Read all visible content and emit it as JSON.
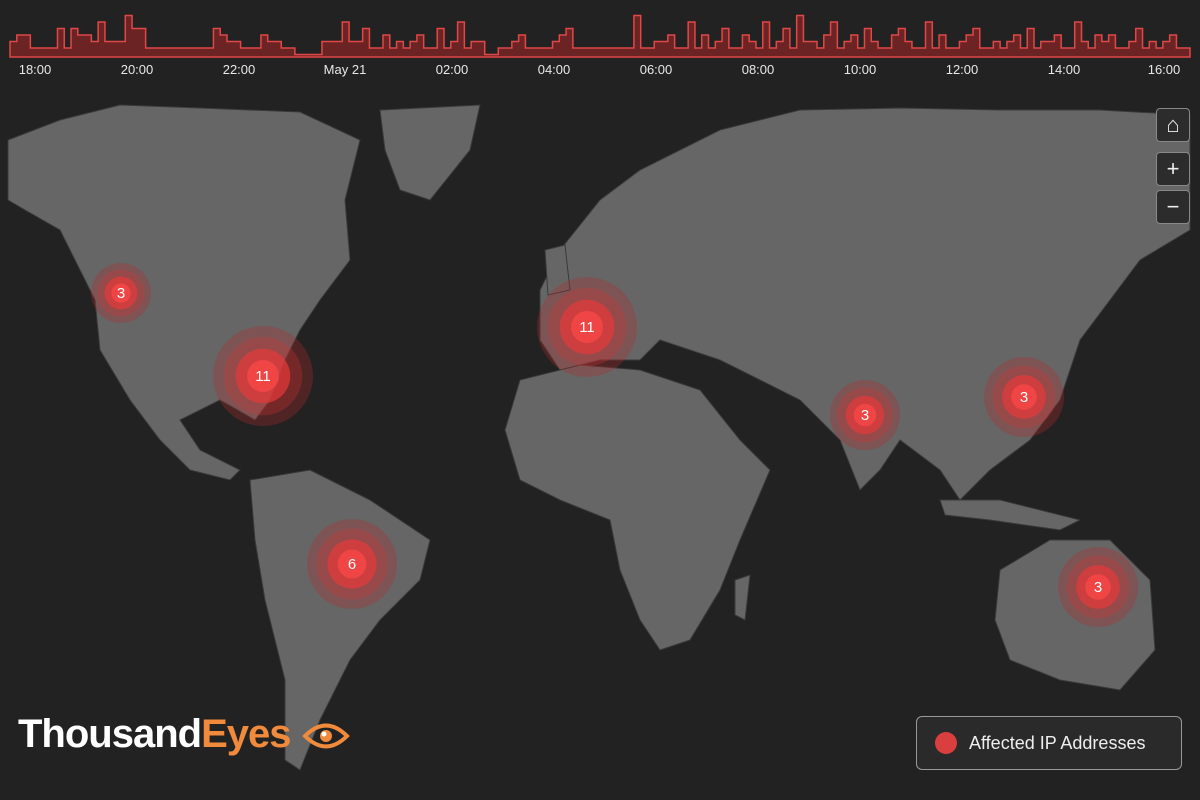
{
  "timeline": {
    "ticks": [
      "18:00",
      "20:00",
      "22:00",
      "May 21",
      "02:00",
      "04:00",
      "06:00",
      "08:00",
      "10:00",
      "12:00",
      "14:00",
      "16:00"
    ],
    "values": [
      1,
      2,
      2,
      0,
      0,
      0,
      0,
      3,
      0,
      3,
      2,
      2,
      1,
      4,
      1,
      1,
      1,
      5,
      3,
      3,
      0,
      0,
      0,
      0,
      0,
      0,
      0,
      0,
      0,
      0,
      3,
      2,
      1,
      1,
      0,
      0,
      0,
      2,
      1,
      1,
      0,
      0,
      -1,
      -1,
      -1,
      -1,
      1,
      1,
      1,
      4,
      1,
      1,
      3,
      0,
      0,
      2,
      0,
      1,
      0,
      1,
      2,
      0,
      0,
      3,
      0,
      1,
      4,
      0,
      1,
      1,
      -1,
      -1,
      0,
      0,
      1,
      2,
      0,
      0,
      0,
      0,
      1,
      2,
      3,
      0,
      0,
      0,
      0,
      0,
      0,
      0,
      0,
      0,
      5,
      0,
      0,
      1,
      1,
      2,
      0,
      0,
      4,
      0,
      2,
      0,
      1,
      3,
      0,
      0,
      2,
      1,
      0,
      4,
      0,
      1,
      3,
      0,
      5,
      1,
      1,
      0,
      2,
      4,
      0,
      1,
      2,
      0,
      3,
      1,
      0,
      0,
      2,
      3,
      1,
      0,
      0,
      4,
      0,
      2,
      0,
      0,
      1,
      2,
      3,
      0,
      0,
      1,
      0,
      1,
      2,
      0,
      3,
      0,
      1,
      1,
      2,
      0,
      0,
      4,
      1,
      0,
      2,
      1,
      2,
      0,
      0,
      1,
      3,
      0,
      1,
      0,
      1,
      2,
      0,
      0
    ],
    "line_color": "#e04848",
    "fill_color": "#6b2323"
  },
  "controls": {
    "home_icon": "⌂",
    "zoom_in": "+",
    "zoom_out": "−"
  },
  "clusters": [
    {
      "label": "3",
      "location": "Pacific Northwest"
    },
    {
      "label": "11",
      "location": "Eastern US"
    },
    {
      "label": "11",
      "location": "Western Europe"
    },
    {
      "label": "3",
      "location": "India"
    },
    {
      "label": "3",
      "location": "East China"
    },
    {
      "label": "6",
      "location": "Brazil"
    },
    {
      "label": "3",
      "location": "Australia"
    }
  ],
  "logo": {
    "part1": "Thousand",
    "part2": "Eyes",
    "color1": "#ffffff",
    "color2": "#f08a3c"
  },
  "legend": {
    "label": "Affected IP Addresses",
    "color": "#d93f3f"
  },
  "colors": {
    "background": "#222222",
    "land": "#666666",
    "cluster": "#e53b3b"
  }
}
